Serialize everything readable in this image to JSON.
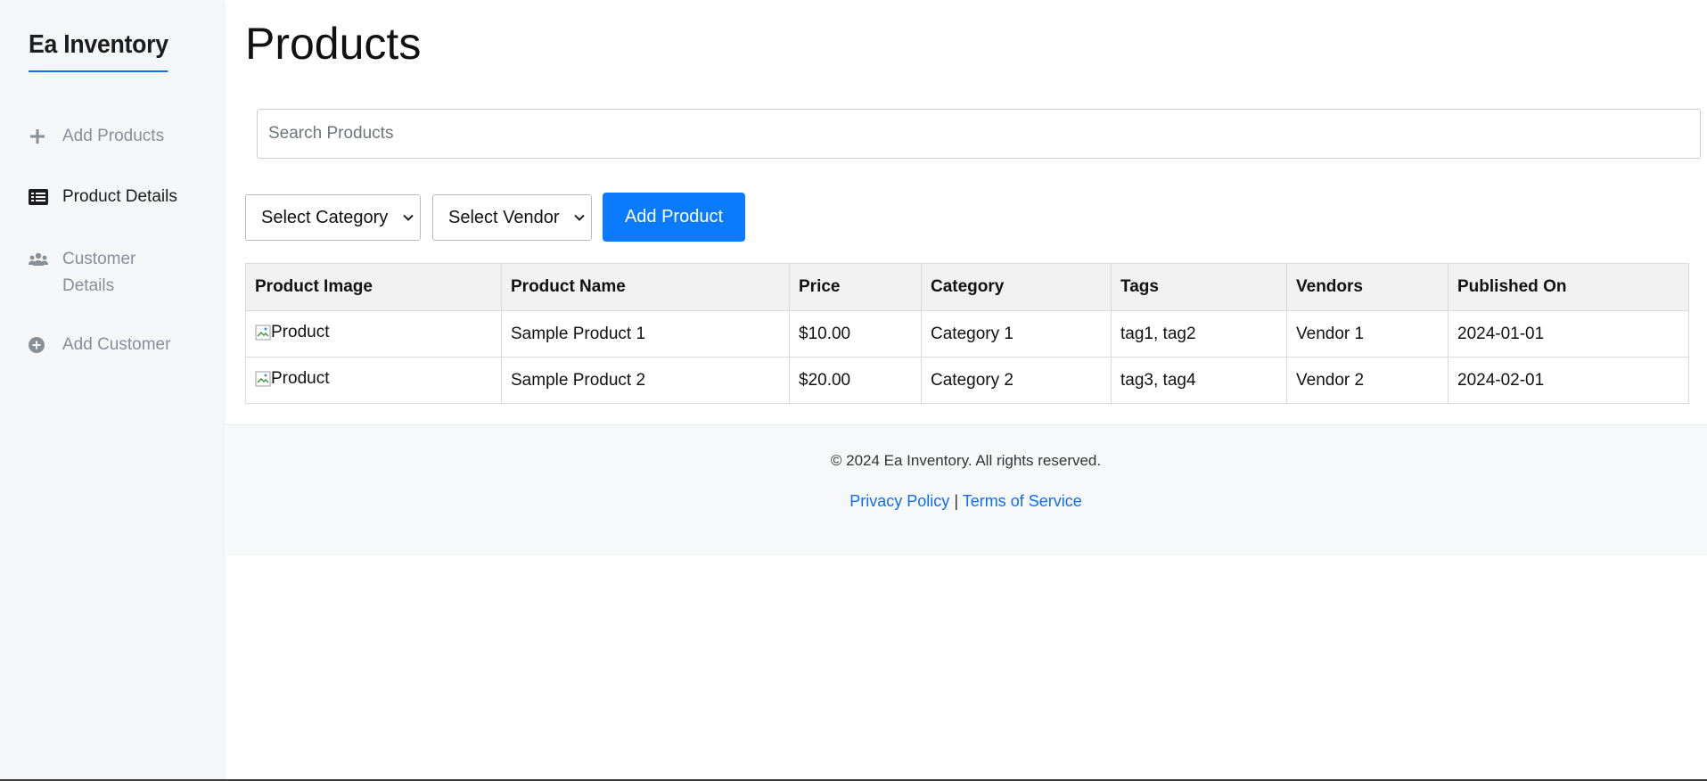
{
  "sidebar": {
    "brand": "Ea Inventory",
    "items": [
      {
        "label": "Add Products",
        "icon": "plus-icon",
        "active": false
      },
      {
        "label": "Product Details",
        "icon": "list-icon",
        "active": true
      },
      {
        "label": "Customer Details",
        "icon": "users-icon",
        "active": false
      },
      {
        "label": "Add Customer",
        "icon": "plus-circle-icon",
        "active": false
      }
    ]
  },
  "main": {
    "title": "Products",
    "search": {
      "placeholder": "Search Products",
      "value": ""
    },
    "category_select": {
      "selected": "Select Category"
    },
    "vendor_select": {
      "selected": "Select Vendor"
    },
    "add_button": "Add Product",
    "table": {
      "headers": [
        "Product Image",
        "Product Name",
        "Price",
        "Category",
        "Tags",
        "Vendors",
        "Published On"
      ],
      "rows": [
        {
          "image_alt": "Product",
          "name": "Sample Product 1",
          "price": "$10.00",
          "category": "Category 1",
          "tags": "tag1, tag2",
          "vendor": "Vendor 1",
          "published": "2024-01-01"
        },
        {
          "image_alt": "Product",
          "name": "Sample Product 2",
          "price": "$20.00",
          "category": "Category 2",
          "tags": "tag3, tag4",
          "vendor": "Vendor 2",
          "published": "2024-02-01"
        }
      ]
    }
  },
  "footer": {
    "copyright": "© 2024 Ea Inventory. All rights reserved.",
    "privacy": "Privacy Policy",
    "separator": "|",
    "terms": "Terms of Service"
  },
  "colors": {
    "accent": "#0a7bff",
    "link": "#0d6efd",
    "sidebar_bg": "#f5f6f8"
  }
}
